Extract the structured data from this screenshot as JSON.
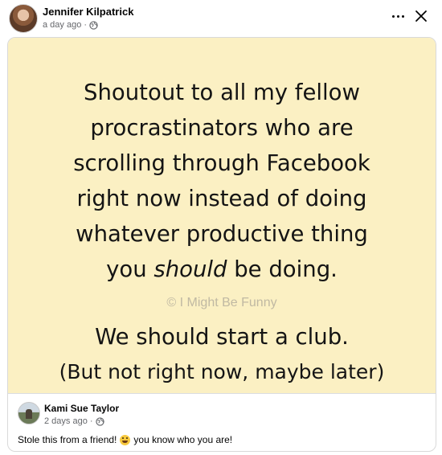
{
  "post": {
    "author": "Jennifer Kilpatrick",
    "timestamp": "a day ago",
    "separator": "·",
    "privacy_icon": "globe-icon"
  },
  "shared": {
    "image": {
      "background_color": "#fbf0c3",
      "line1": "Shoutout to all my fellow",
      "line2": "procrastinators who are",
      "line3": "scrolling through Facebook",
      "line4": "right now instead of doing",
      "line5": "whatever productive thing",
      "line6_before": "you ",
      "line6_emphasis": "should",
      "line6_after": " be doing.",
      "watermark": "© I Might Be Funny",
      "line7": "We should start a club.",
      "line8": "(But not right now, maybe later)"
    },
    "author": "Kami Sue Taylor",
    "timestamp": "2 days ago",
    "separator": "·",
    "privacy_icon": "globe-icon",
    "caption_before": "Stole this from a friend!",
    "caption_emoji": "laughing-emoji",
    "caption_after": "you know who you are!"
  },
  "actions": {
    "more_icon": "more-horizontal-icon",
    "close_icon": "close-icon"
  }
}
